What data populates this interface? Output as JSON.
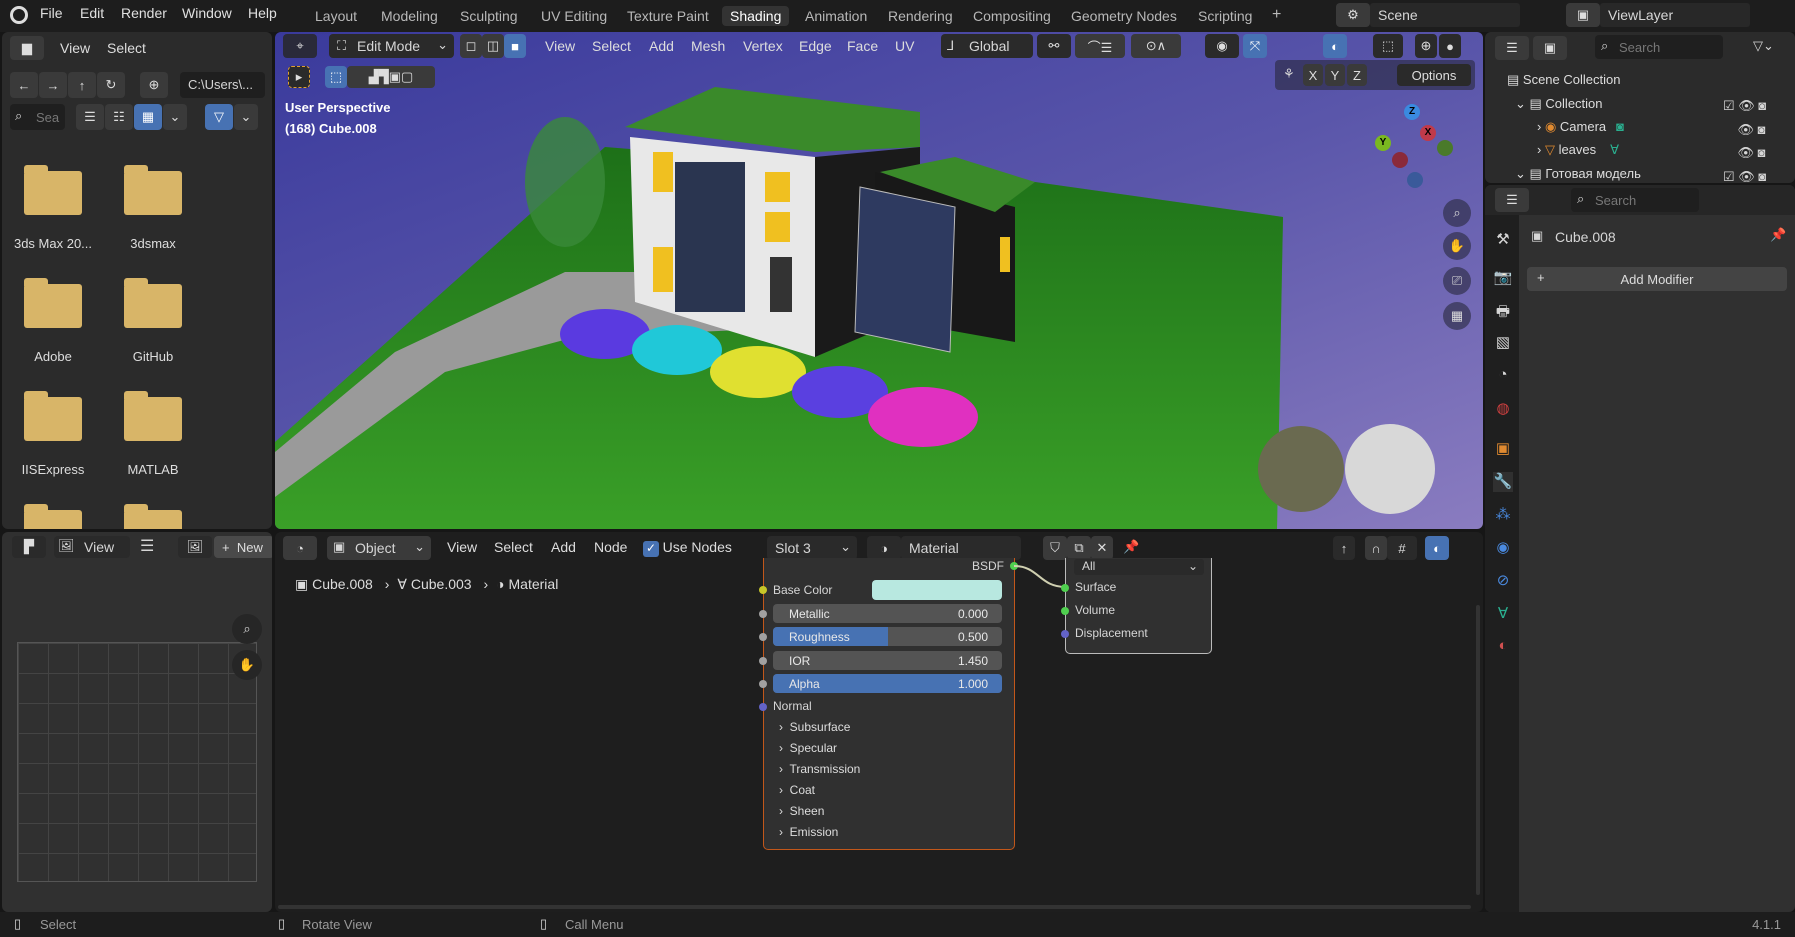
{
  "topbar": {
    "menus": [
      "File",
      "Edit",
      "Render",
      "Window",
      "Help"
    ],
    "workspaces": [
      "Layout",
      "Modeling",
      "Sculpting",
      "UV Editing",
      "Texture Paint",
      "Shading",
      "Animation",
      "Rendering",
      "Compositing",
      "Geometry Nodes",
      "Scripting"
    ],
    "active_workspace": "Shading",
    "add_workspace": "+",
    "scene": "Scene",
    "view_layer": "ViewLayer"
  },
  "file_browser": {
    "menus": [
      "View",
      "Select"
    ],
    "path": "C:\\Users\\...",
    "search_placeholder": "Sea",
    "folders": [
      "3ds Max 20...",
      "3dsmax",
      "Adobe",
      "GitHub",
      "IISExpress",
      "MATLAB"
    ]
  },
  "viewport": {
    "mode": "Edit Mode",
    "menus": [
      "View",
      "Select",
      "Add",
      "Mesh",
      "Vertex",
      "Edge",
      "Face",
      "UV"
    ],
    "orientation": "Global",
    "axes": [
      "X",
      "Y",
      "Z"
    ],
    "options": "Options",
    "overlay_title": "User Perspective",
    "overlay_object": "(168) Cube.008",
    "gizmo": {
      "x": "X",
      "y": "Y",
      "z": "Z"
    }
  },
  "outliner": {
    "search_placeholder": "Search",
    "items": [
      {
        "label": "Scene Collection",
        "level": 0
      },
      {
        "label": "Collection",
        "level": 1
      },
      {
        "label": "Camera",
        "level": 2
      },
      {
        "label": "leaves",
        "level": 2
      },
      {
        "label": "Готовая модель",
        "level": 1
      }
    ]
  },
  "properties": {
    "search_placeholder": "Search",
    "object": "Cube.008",
    "add_modifier": "Add Modifier"
  },
  "image_editor": {
    "view": "View",
    "new": "New"
  },
  "node_editor": {
    "object_mode": "Object",
    "menus": [
      "View",
      "Select",
      "Add",
      "Node"
    ],
    "use_nodes": "Use Nodes",
    "use_nodes_checked": true,
    "slot": "Slot 3",
    "material": "Material",
    "breadcrumb": [
      "Cube.008",
      "Cube.003",
      "Material"
    ],
    "bsdf": {
      "output": "BSDF",
      "base_color_label": "Base Color",
      "base_color": "#b8e8e0",
      "fields": [
        {
          "label": "Metallic",
          "value": "0.000",
          "fill": 0
        },
        {
          "label": "Roughness",
          "value": "0.500",
          "fill": 0.5
        },
        {
          "label": "IOR",
          "value": "1.450",
          "fill": 0
        },
        {
          "label": "Alpha",
          "value": "1.000",
          "fill": 1
        }
      ],
      "normal": "Normal",
      "sections": [
        "Subsurface",
        "Specular",
        "Transmission",
        "Coat",
        "Sheen",
        "Emission"
      ]
    },
    "output_node": {
      "target": "All",
      "inputs": [
        "Surface",
        "Volume",
        "Displacement"
      ]
    }
  },
  "statusbar": {
    "select": "Select",
    "rotate": "Rotate View",
    "call_menu": "Call Menu",
    "version": "4.1.1"
  },
  "colors": {
    "accent": "#4772b3",
    "node_border": "#c2571a",
    "folder": "#d8b568"
  }
}
